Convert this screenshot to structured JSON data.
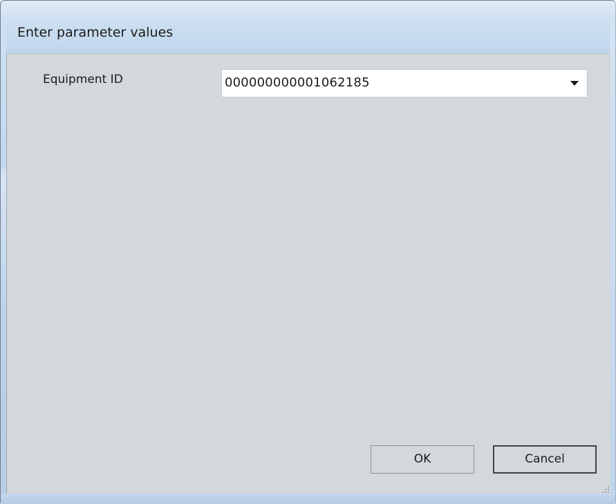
{
  "window": {
    "title": "Enter parameter values"
  },
  "form": {
    "equipment_id": {
      "label": "Equipment ID",
      "value": "000000000001062185"
    }
  },
  "buttons": {
    "ok_label": "OK",
    "cancel_label": "Cancel"
  },
  "icons": {
    "dropdown": "chevron-down-icon",
    "resize": "resize-grip-icon"
  },
  "colors": {
    "title_bar": "#c9dcf0",
    "client_background": "#d4d7db",
    "input_background": "#ffffff"
  }
}
